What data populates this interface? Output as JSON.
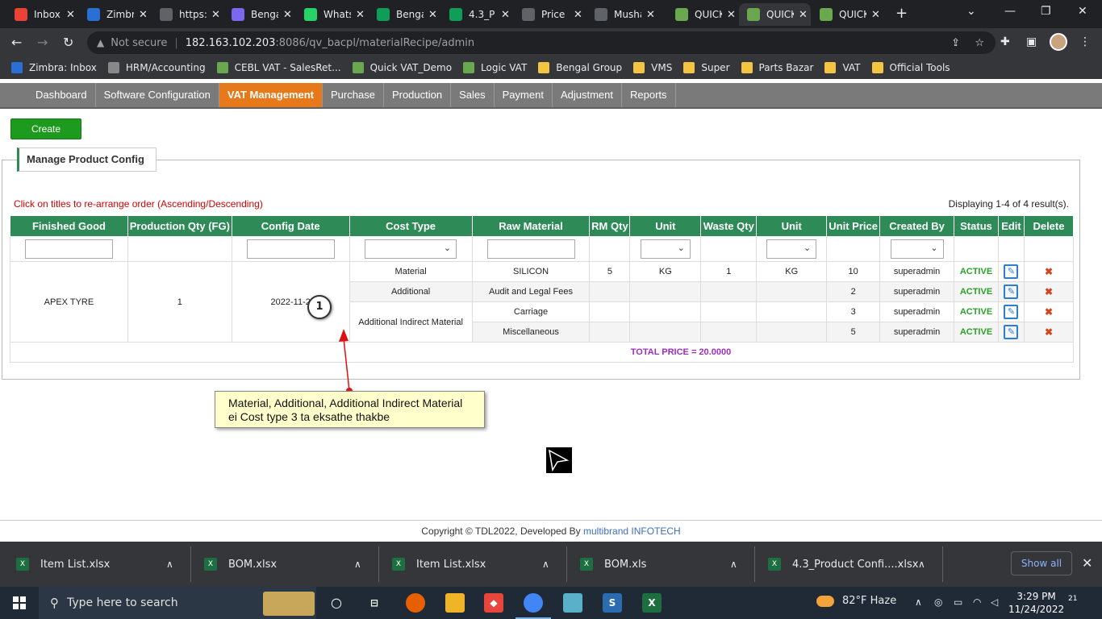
{
  "browser": {
    "tabs": [
      {
        "title": "Inbox",
        "icon": "gmail-icon",
        "color": "#ea4335"
      },
      {
        "title": "Zimbra",
        "icon": "zimbra-icon",
        "color": "#2a6fd4"
      },
      {
        "title": "https:",
        "icon": "globe-icon",
        "color": "#5f6368"
      },
      {
        "title": "Bengal",
        "icon": "clickup-icon",
        "color": "#7b68ee"
      },
      {
        "title": "WhatsApp",
        "icon": "whatsapp-icon",
        "color": "#25d366"
      },
      {
        "title": "Bengal",
        "icon": "sheets-icon",
        "color": "#0f9d58"
      },
      {
        "title": "4.3_P",
        "icon": "sheets-icon",
        "color": "#0f9d58"
      },
      {
        "title": "Price",
        "icon": "globe-icon",
        "color": "#5f6368"
      },
      {
        "title": "Mushak",
        "icon": "globe-icon",
        "color": "#5f6368"
      },
      {
        "title": "QUICK",
        "icon": "gear-icon",
        "color": "#6aa84f"
      },
      {
        "title": "QUICK",
        "icon": "gear-icon",
        "color": "#6aa84f"
      },
      {
        "title": "QUICK",
        "icon": "gear-icon",
        "color": "#6aa84f"
      }
    ],
    "address": {
      "security_label": "Not secure",
      "host": "182.163.102.203",
      "path": ":8086/qv_bacpl/materialRecipe/admin"
    },
    "bookmarks": [
      {
        "label": "Zimbra: Inbox",
        "color": "#2a6fd4"
      },
      {
        "label": "HRM/Accounting",
        "color": "#888888"
      },
      {
        "label": "CEBL VAT - SalesRet...",
        "color": "#6aa84f"
      },
      {
        "label": "Quick VAT_Demo",
        "color": "#6aa84f"
      },
      {
        "label": "Logic VAT",
        "color": "#6aa84f"
      },
      {
        "label": "Bengal Group",
        "color": "#f4c542"
      },
      {
        "label": "VMS",
        "color": "#f4c542"
      },
      {
        "label": "Super",
        "color": "#f4c542"
      },
      {
        "label": "Parts Bazar",
        "color": "#f4c542"
      },
      {
        "label": "VAT",
        "color": "#f4c542"
      },
      {
        "label": "Official Tools",
        "color": "#f4c542"
      }
    ]
  },
  "menu": {
    "items": [
      "Dashboard",
      "Software Configuration",
      "VAT Management",
      "Purchase",
      "Production",
      "Sales",
      "Payment",
      "Adjustment",
      "Reports"
    ],
    "active": "VAT Management"
  },
  "page": {
    "create_label": "Create",
    "section_title": "Manage Product Config",
    "hint": "Click on titles to re-arrange order (Ascending/Descending)",
    "summary": "Displaying 1-4 of 4 result(s)."
  },
  "table": {
    "columns": [
      "Finished Good",
      "Production Qty (FG)",
      "Config Date",
      "Cost Type",
      "Raw Material",
      "RM Qty",
      "Unit",
      "Waste Qty",
      "Unit",
      "Unit Price",
      "Created By",
      "Status",
      "Edit",
      "Delete"
    ],
    "group": {
      "finished_good": "APEX TYRE",
      "production_qty": "1",
      "config_date": "2022-11-2"
    },
    "rows": [
      {
        "cost_type": "Material",
        "raw_material": "SILICON",
        "rm_qty": "5",
        "unit": "KG",
        "waste_qty": "1",
        "waste_unit": "KG",
        "unit_price": "10",
        "created_by": "superadmin",
        "status": "ACTIVE"
      },
      {
        "cost_type": "Additional",
        "raw_material": "Audit and Legal Fees",
        "rm_qty": "",
        "unit": "",
        "waste_qty": "",
        "waste_unit": "",
        "unit_price": "2",
        "created_by": "superadmin",
        "status": "ACTIVE"
      },
      {
        "cost_type": "Additional Indirect Material",
        "raw_material": "Carriage",
        "rm_qty": "",
        "unit": "",
        "waste_qty": "",
        "waste_unit": "",
        "unit_price": "3",
        "created_by": "superadmin",
        "status": "ACTIVE"
      },
      {
        "cost_type": "",
        "raw_material": "Miscellaneous",
        "rm_qty": "",
        "unit": "",
        "waste_qty": "",
        "waste_unit": "",
        "unit_price": "5",
        "created_by": "superadmin",
        "status": "ACTIVE"
      }
    ],
    "total": "TOTAL PRICE = 20.0000"
  },
  "annotation": {
    "marker": "1",
    "callout_line1": "Material, Additional, Additional Indirect Material",
    "callout_line2": "ei Cost type 3 ta eksathe thakbe"
  },
  "footer": {
    "text": "Copyright © TDL2022, Developed By ",
    "developer": "multibrand INFOTECH"
  },
  "downloads": {
    "items": [
      "Item List.xlsx",
      "BOM.xlsx",
      "Item List.xlsx",
      "BOM.xls",
      "4.3_Product Confi....xlsx"
    ],
    "show_all": "Show all"
  },
  "taskbar": {
    "search_placeholder": "Type here to search",
    "weather": "82°F  Haze",
    "time": "3:29 PM",
    "date": "11/24/2022",
    "notifications": "21"
  }
}
